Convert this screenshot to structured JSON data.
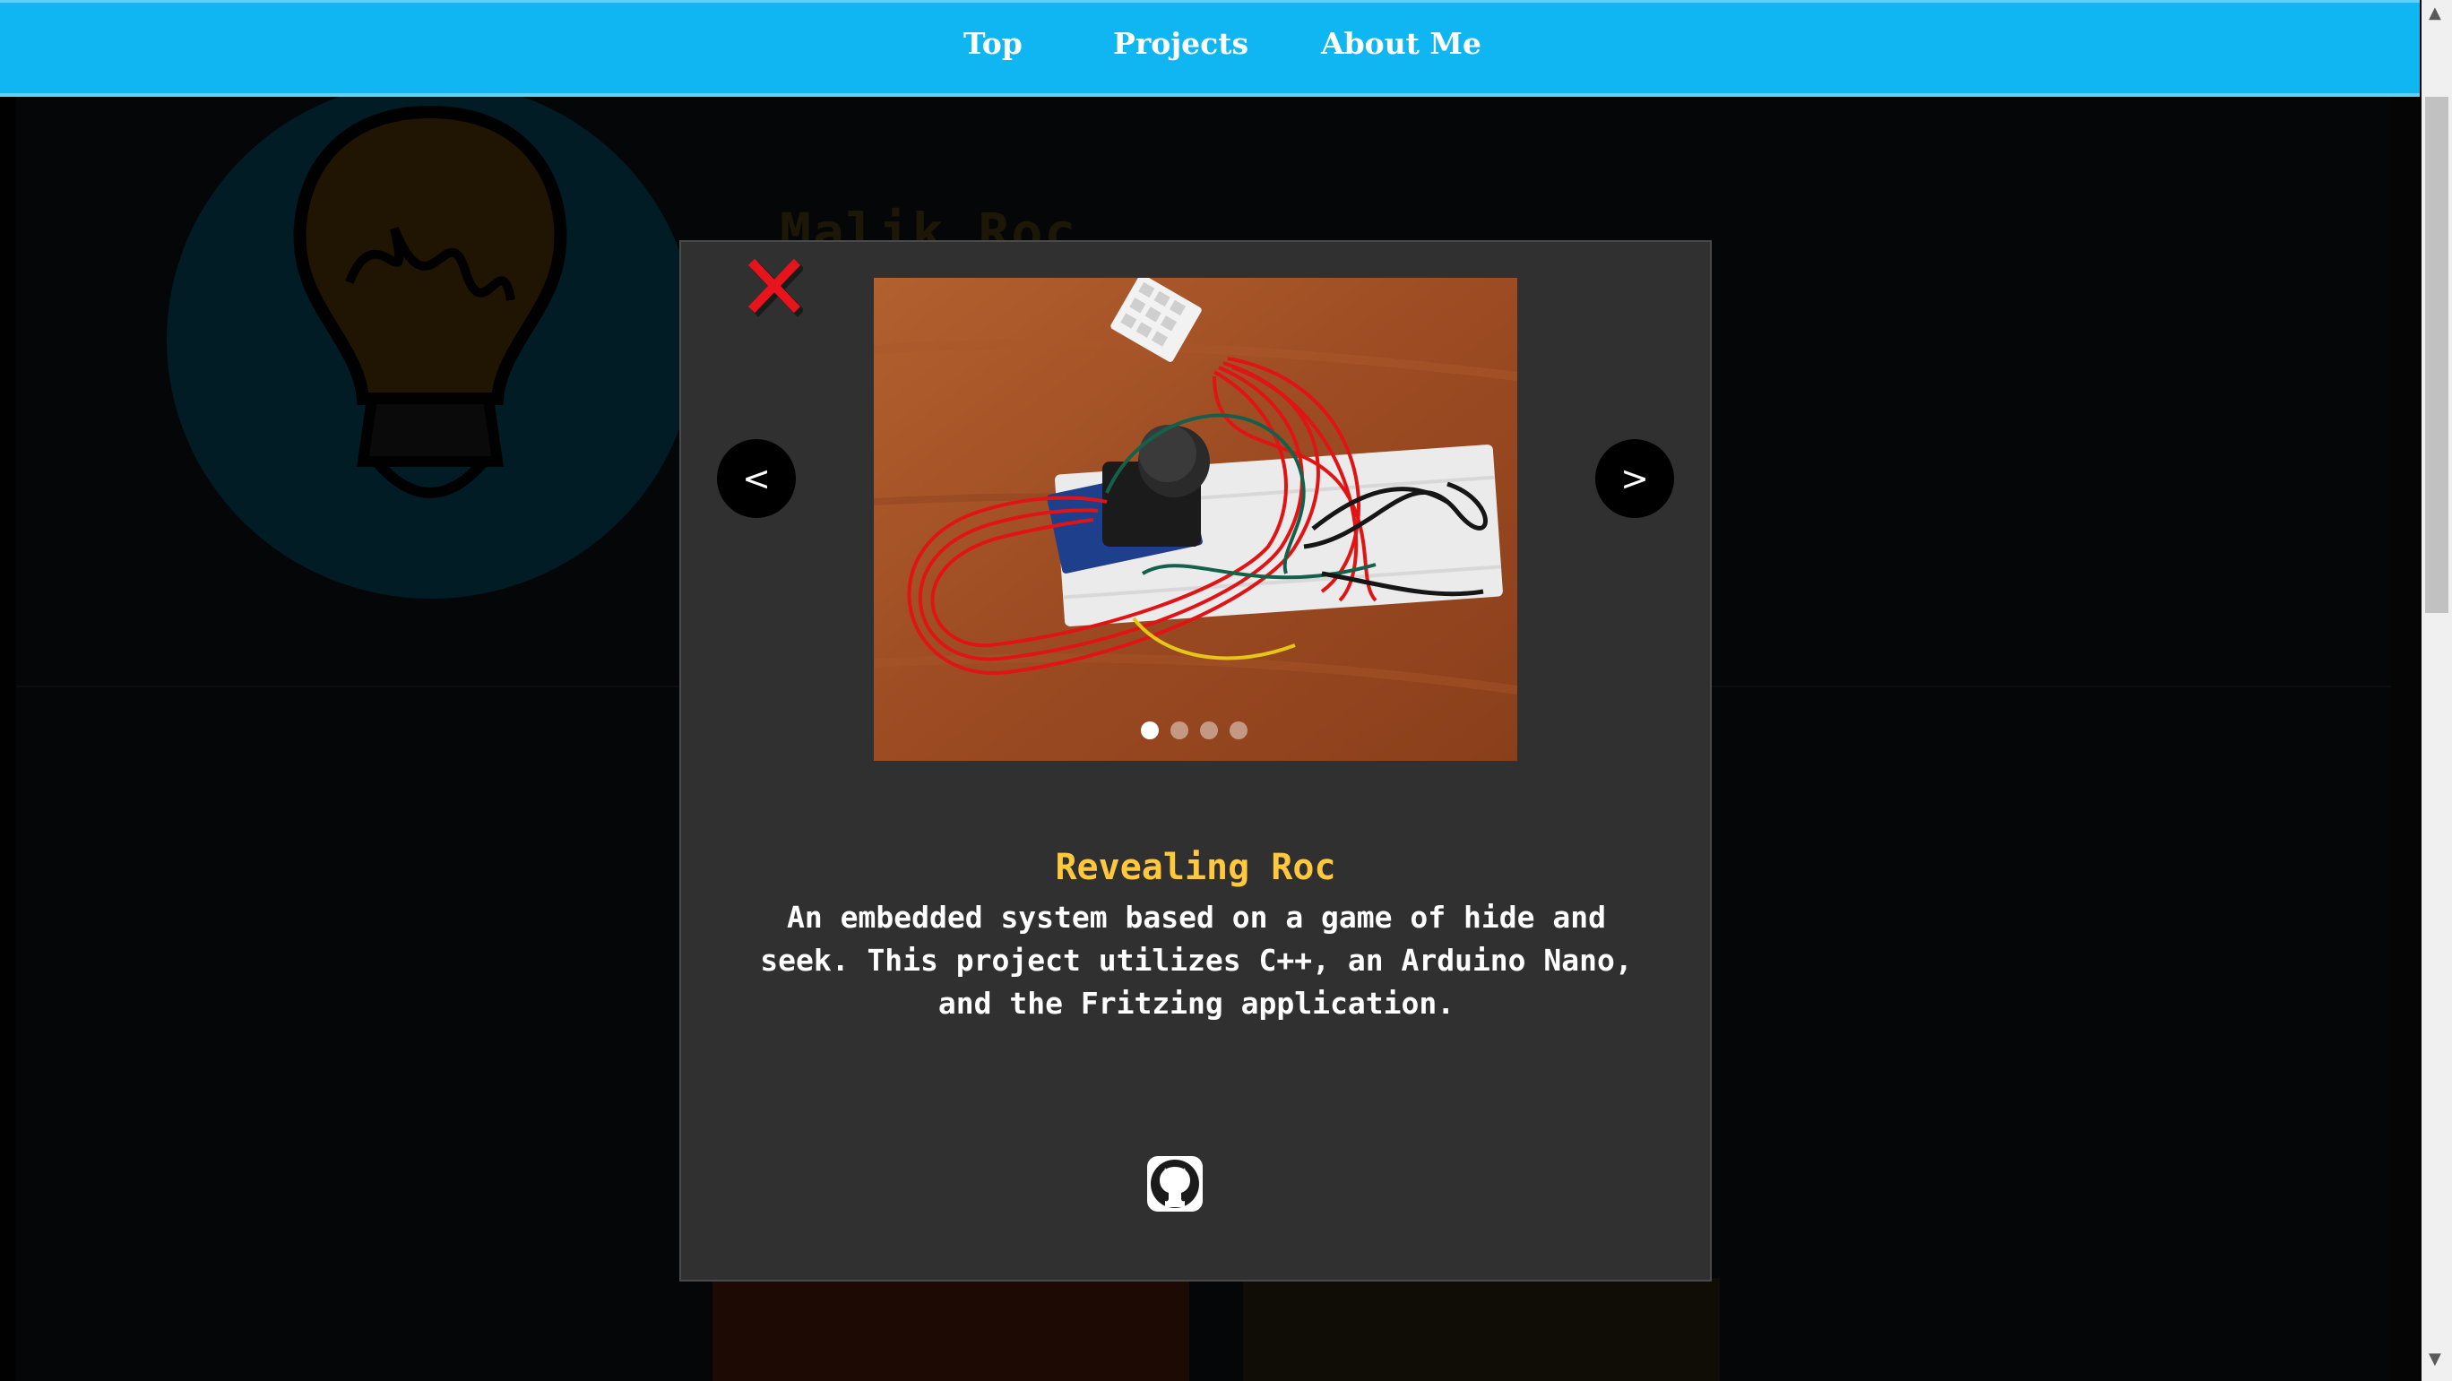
{
  "nav": {
    "items": [
      {
        "label": "Top"
      },
      {
        "label": "Projects"
      },
      {
        "label": "About Me"
      }
    ]
  },
  "background": {
    "name": "Malik Roc"
  },
  "modal": {
    "close_icon": "close-icon",
    "prev_label": "<",
    "next_label": ">",
    "slide_count": 4,
    "active_slide": 1,
    "title": "Revealing Roc",
    "description": "An embedded system based on a game of hide and seek. This project utilizes C++, an Arduino Nano, and the Fritzing application.",
    "link_icon": "github-icon"
  },
  "colors": {
    "navbar": "#10b6f2",
    "modal_bg": "#303030",
    "title": "#ffc83d",
    "close": "#e8141c"
  }
}
